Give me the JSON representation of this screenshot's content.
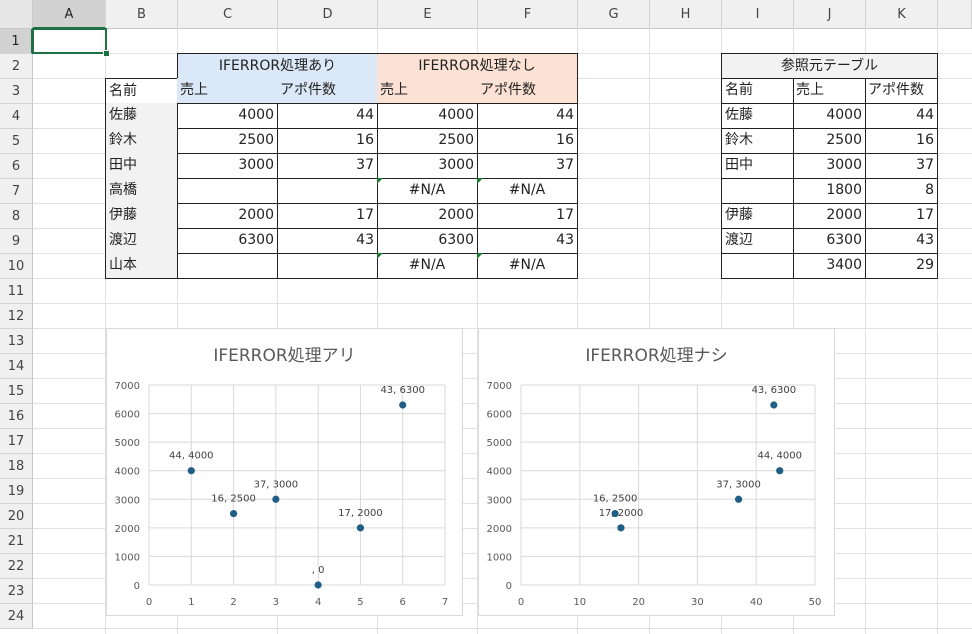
{
  "columns": [
    "A",
    "B",
    "C",
    "D",
    "E",
    "F",
    "G",
    "H",
    "I",
    "J",
    "K"
  ],
  "rows": [
    "1",
    "2",
    "3",
    "4",
    "5",
    "6",
    "7",
    "8",
    "9",
    "10",
    "11",
    "12",
    "13",
    "14",
    "15",
    "16",
    "17",
    "18",
    "19",
    "20",
    "21",
    "22",
    "23",
    "24"
  ],
  "tables": {
    "with_header": "IFERROR処理あり",
    "without_header": "IFERROR処理なし",
    "ref_header": "参照元テーブル",
    "col_name": "名前",
    "col_sales": "売上",
    "col_appo": "アポ件数",
    "left_rows": [
      {
        "name": "佐藤",
        "c": "4000",
        "d": "44",
        "e": "4000",
        "f": "44",
        "err": false
      },
      {
        "name": "鈴木",
        "c": "2500",
        "d": "16",
        "e": "2500",
        "f": "16",
        "err": false
      },
      {
        "name": "田中",
        "c": "3000",
        "d": "37",
        "e": "3000",
        "f": "37",
        "err": false
      },
      {
        "name": "高橋",
        "c": "",
        "d": "",
        "e": "#N/A",
        "f": "#N/A",
        "err": true
      },
      {
        "name": "伊藤",
        "c": "2000",
        "d": "17",
        "e": "2000",
        "f": "17",
        "err": false
      },
      {
        "name": "渡辺",
        "c": "6300",
        "d": "43",
        "e": "6300",
        "f": "43",
        "err": false
      },
      {
        "name": "山本",
        "c": "",
        "d": "",
        "e": "#N/A",
        "f": "#N/A",
        "err": true
      }
    ],
    "ref_rows": [
      {
        "name": "佐藤",
        "sales": "4000",
        "appo": "44"
      },
      {
        "name": "鈴木",
        "sales": "2500",
        "appo": "16"
      },
      {
        "name": "田中",
        "sales": "3000",
        "appo": "37"
      },
      {
        "name": "",
        "sales": "1800",
        "appo": "8"
      },
      {
        "name": "伊藤",
        "sales": "2000",
        "appo": "17"
      },
      {
        "name": "渡辺",
        "sales": "6300",
        "appo": "43"
      },
      {
        "name": "",
        "sales": "3400",
        "appo": "29"
      }
    ]
  },
  "chart_data": [
    {
      "type": "scatter",
      "title": "IFERROR処理アリ",
      "xlim": [
        0,
        7
      ],
      "ylim": [
        0,
        7000
      ],
      "xticks": [
        0,
        1,
        2,
        3,
        4,
        5,
        6,
        7
      ],
      "yticks": [
        0,
        1000,
        2000,
        3000,
        4000,
        5000,
        6000,
        7000
      ],
      "grid": true,
      "points": [
        {
          "x": 1,
          "y": 4000,
          "label": "44, 4000"
        },
        {
          "x": 2,
          "y": 2500,
          "label": "16, 2500"
        },
        {
          "x": 3,
          "y": 3000,
          "label": "37, 3000"
        },
        {
          "x": 4,
          "y": 0,
          "label": ", 0"
        },
        {
          "x": 5,
          "y": 2000,
          "label": "17, 2000"
        },
        {
          "x": 6,
          "y": 6300,
          "label": "43, 6300"
        }
      ],
      "color": "#1f5f86"
    },
    {
      "type": "scatter",
      "title": "IFERROR処理ナシ",
      "xlim": [
        0,
        50
      ],
      "ylim": [
        0,
        7000
      ],
      "xticks": [
        0,
        10,
        20,
        30,
        40,
        50
      ],
      "yticks": [
        0,
        1000,
        2000,
        3000,
        4000,
        5000,
        6000,
        7000
      ],
      "grid": true,
      "points": [
        {
          "x": 44,
          "y": 4000,
          "label": "44, 4000"
        },
        {
          "x": 16,
          "y": 2500,
          "label": "16, 2500"
        },
        {
          "x": 37,
          "y": 3000,
          "label": "37, 3000"
        },
        {
          "x": 17,
          "y": 2000,
          "label": "17, 2000"
        },
        {
          "x": 43,
          "y": 6300,
          "label": "43, 6300"
        }
      ],
      "color": "#1f5f86"
    }
  ]
}
